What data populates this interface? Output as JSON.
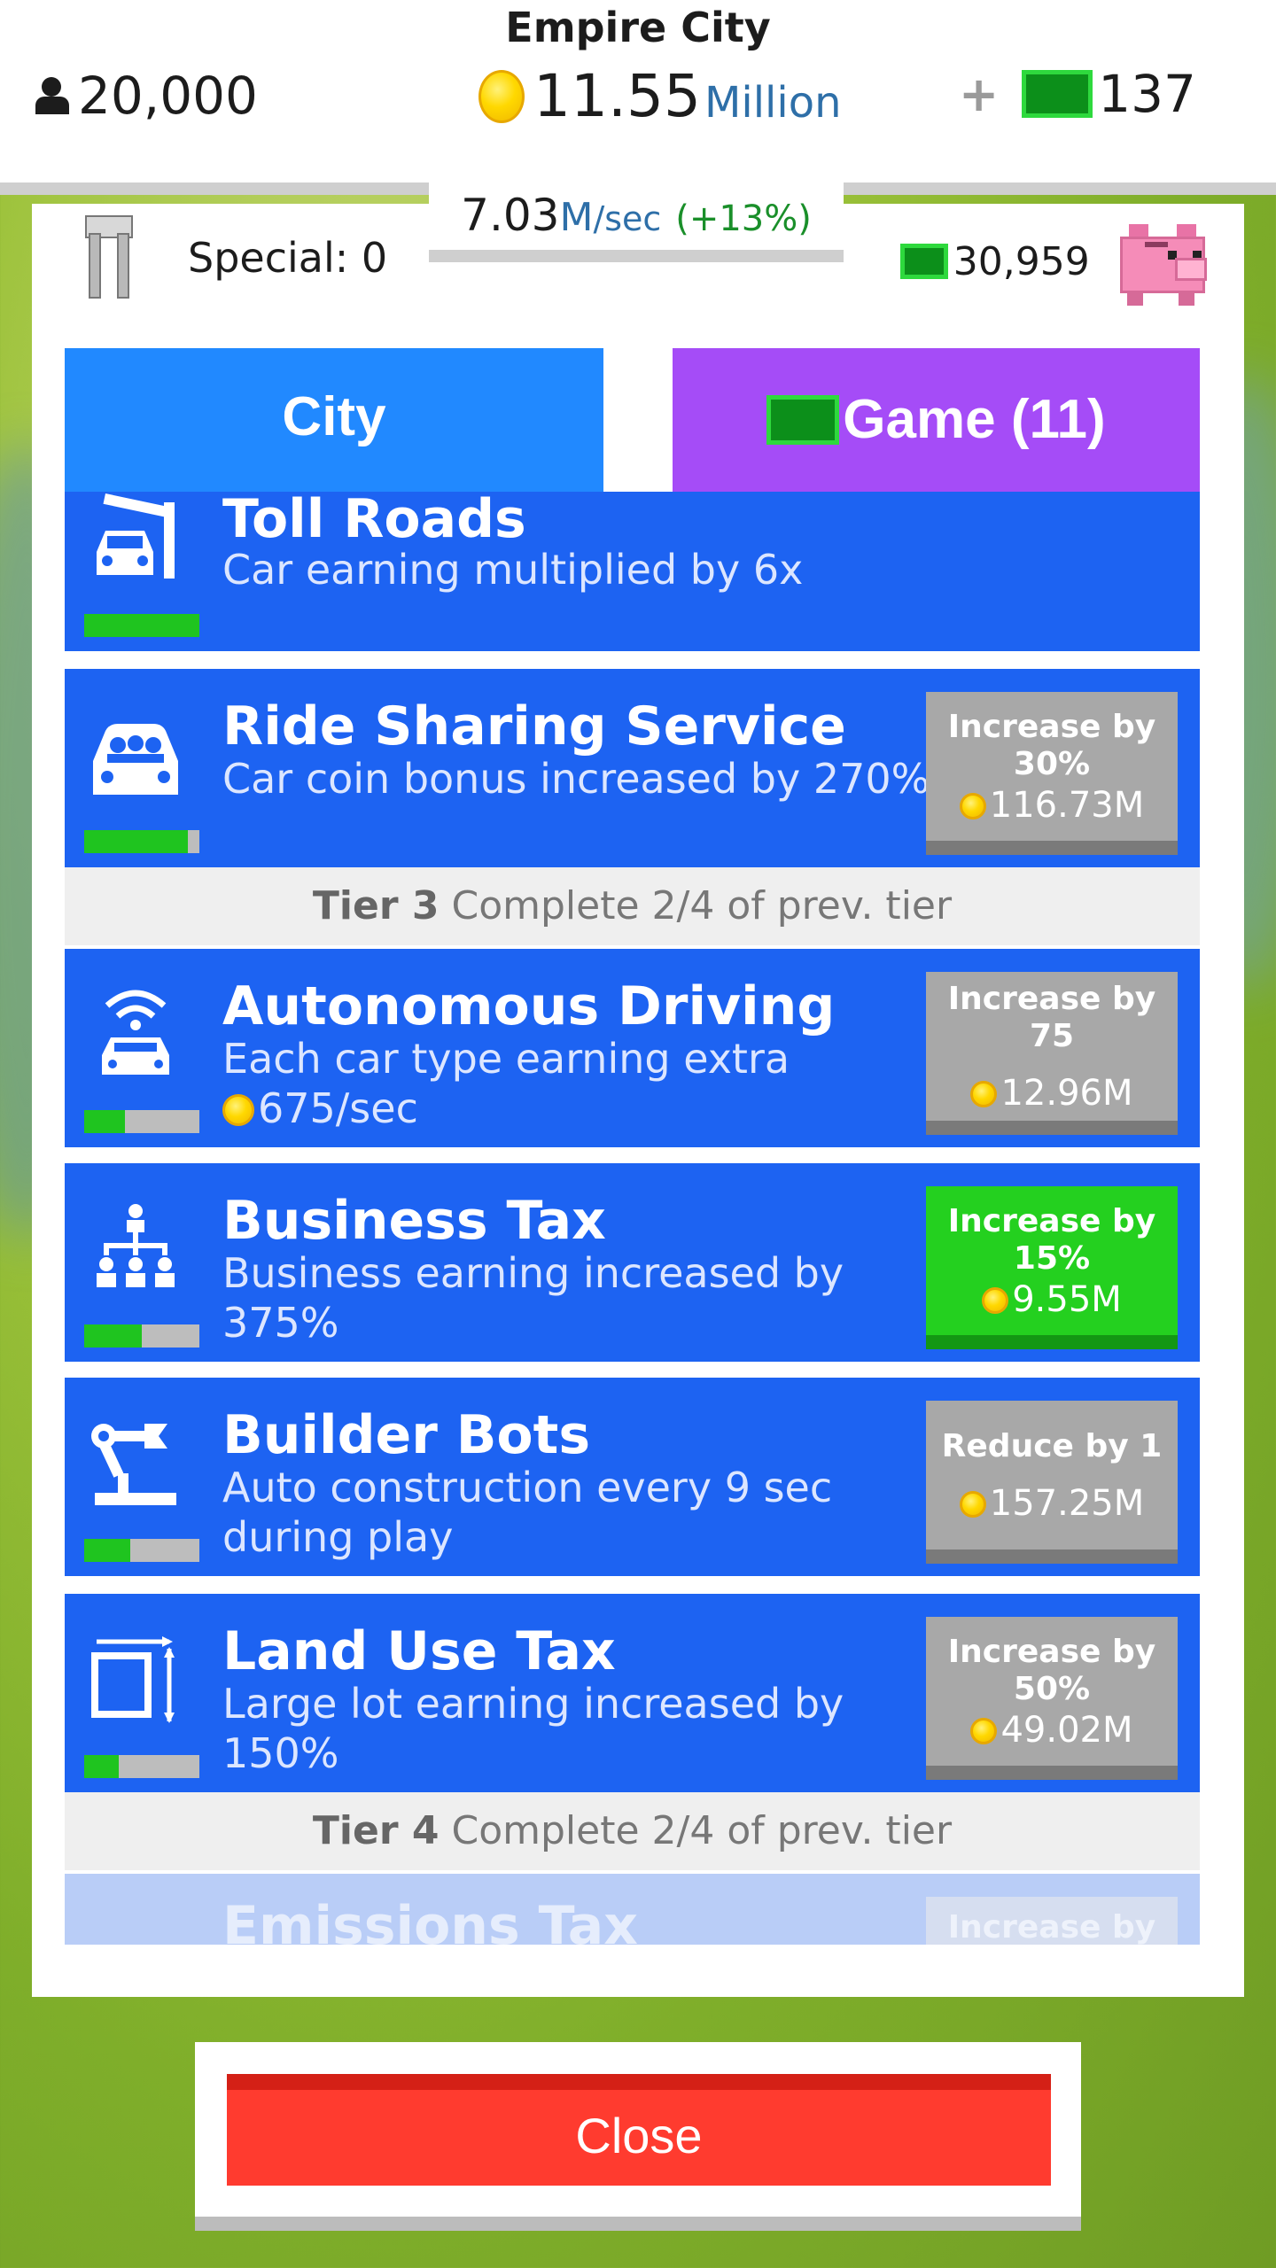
{
  "city_name": "Empire City",
  "header": {
    "population": "20,000",
    "coins_value": "11.55",
    "coins_unit": "Million",
    "plus": "+",
    "cash": "137"
  },
  "rate": {
    "value": "7.03",
    "unit": "M",
    "per": "/sec",
    "percent": "(+13%)"
  },
  "special": {
    "label": "Special: 0"
  },
  "bank": {
    "value": "30,959"
  },
  "tabs": {
    "city": "City",
    "game": "Game (11)"
  },
  "items": [
    {
      "title": "Toll Roads",
      "desc": "Car earning multiplied by 6x",
      "icon": "toll-gate-icon",
      "progress": 1.0
    },
    {
      "title": "Ride Sharing Service",
      "desc": "Car coin bonus increased by 270%",
      "icon": "car-passengers-icon",
      "progress": 0.9,
      "action": "Increase by 30%",
      "cost": "116.73M"
    },
    {
      "title": "Autonomous Driving",
      "desc_line1": "Each car type earning extra",
      "desc_line2": "675/sec",
      "icon": "wifi-car-icon",
      "progress": 0.35,
      "action": "Increase by 75",
      "cost": "12.96M"
    },
    {
      "title": "Business Tax",
      "desc": "Business earning increased by 375%",
      "icon": "org-chart-icon",
      "progress": 0.5,
      "action": "Increase by 15%",
      "cost": "9.55M",
      "affordable": true
    },
    {
      "title": "Builder Bots",
      "desc": "Auto construction every 9 sec during play",
      "icon": "robot-arm-icon",
      "progress": 0.4,
      "action": "Reduce by 1",
      "cost": "157.25M"
    },
    {
      "title": "Land Use Tax",
      "desc": "Large lot earning increased by 150%",
      "icon": "lot-resize-icon",
      "progress": 0.3,
      "action": "Increase by 50%",
      "cost": "49.02M"
    },
    {
      "title": "Emissions Tax",
      "action": "Increase by",
      "faded": true
    }
  ],
  "tiers": [
    {
      "name": "Tier 3",
      "text": "Complete 2/4 of prev. tier"
    },
    {
      "name": "Tier 4",
      "text": "Complete 2/4 of prev. tier"
    }
  ],
  "close_label": "Close",
  "colors": {
    "card_blue": "#1d63f2",
    "tab_city": "#2189ff",
    "tab_game": "#a54cf7",
    "affordable_green": "#24d01f",
    "close_red": "#ff3b2f"
  }
}
